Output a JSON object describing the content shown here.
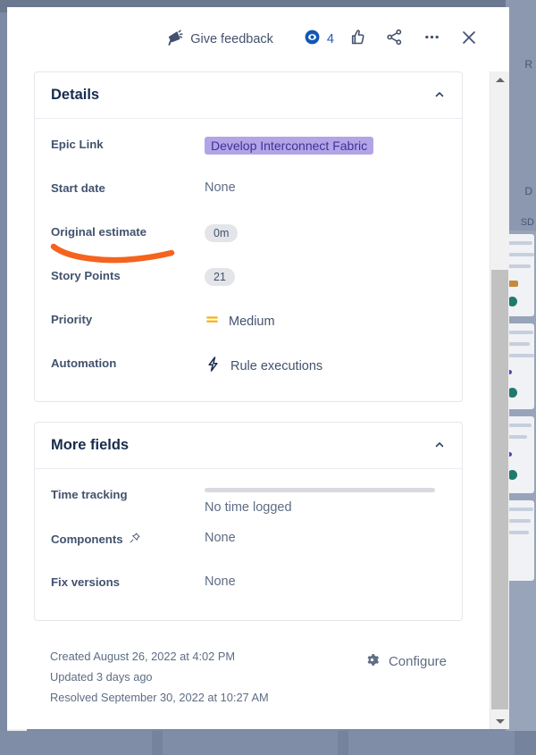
{
  "header": {
    "feedback_label": "Give feedback",
    "feedback_icon": "megaphone-icon",
    "watch_icon": "eye-watch-icon",
    "watch_count": "4",
    "vote_icon": "thumbs-up-icon",
    "share_icon": "share-icon",
    "more_icon": "more-ellipsis-icon",
    "close_icon": "close-x-icon"
  },
  "details_panel": {
    "title": "Details",
    "collapse_icon": "chevron-up-icon",
    "fields": [
      {
        "label": "Epic Link",
        "value": "Develop Interconnect Fabric",
        "kind": "epic-badge"
      },
      {
        "label": "Start date",
        "value": "None",
        "kind": "text"
      },
      {
        "label": "Original estimate",
        "value": "0m",
        "kind": "pill"
      },
      {
        "label": "Story Points",
        "value": "21",
        "kind": "pill"
      },
      {
        "label": "Priority",
        "value": "Medium",
        "kind": "icon-text",
        "icon": "priority-medium-icon"
      },
      {
        "label": "Automation",
        "value": "Rule executions",
        "kind": "icon-text",
        "icon": "lightning-bolt-icon"
      }
    ]
  },
  "more_fields_panel": {
    "title": "More fields",
    "collapse_icon": "chevron-up-icon",
    "fields": [
      {
        "label": "Time tracking",
        "value": "No time logged",
        "kind": "timetrack"
      },
      {
        "label": "Components",
        "value": "None",
        "kind": "text",
        "label_icon": "pin-icon"
      },
      {
        "label": "Fix versions",
        "value": "None",
        "kind": "text"
      }
    ]
  },
  "meta": {
    "created": "Created August 26, 2022 at 4:02 PM",
    "updated": "Updated 3 days ago",
    "resolved": "Resolved September 30, 2022 at 10:27 AM",
    "configure_label": "Configure",
    "configure_icon": "gear-icon"
  },
  "annotation": {
    "type": "orange-underline-stroke",
    "target": "Original estimate",
    "color": "#f4641e"
  },
  "background": {
    "column_label": "SD",
    "heading_partial_1": "R",
    "heading_partial_2": "D"
  },
  "colors": {
    "epic_badge_bg": "#b3a4e8",
    "epic_badge_text": "#403294",
    "accent_blue": "#2257b5",
    "label_text": "#42526e",
    "value_text": "#5e6c84",
    "annotation_orange": "#f4641e",
    "priority_orange": "#ffab00",
    "desktop_blue": "#76839c"
  }
}
